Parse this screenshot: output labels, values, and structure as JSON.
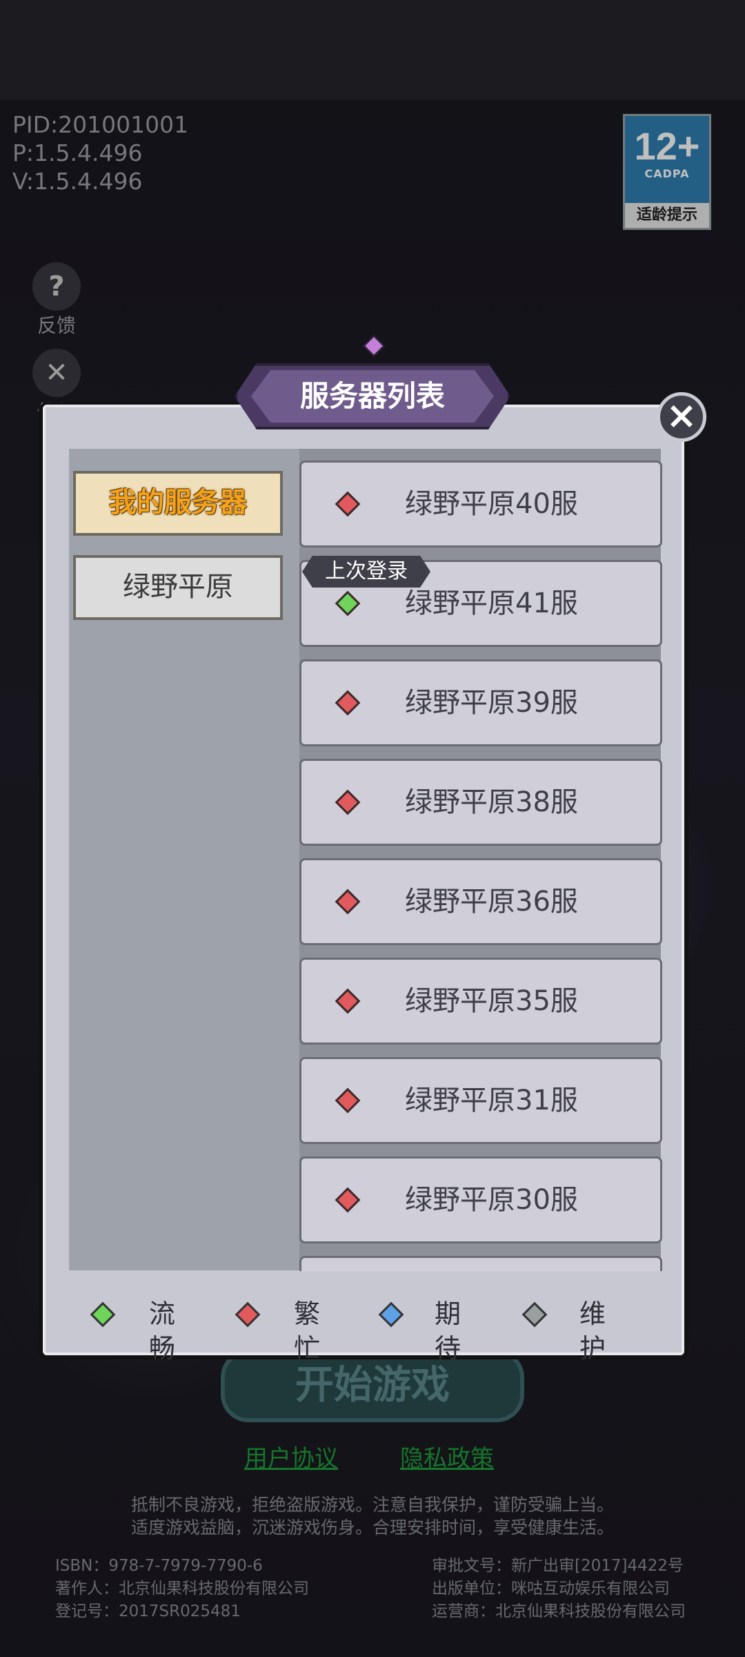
{
  "header": {
    "pid": "PID:201001001",
    "p_version": "P:1.5.4.496",
    "v_version": "V:1.5.4.496"
  },
  "age_rating": {
    "number": "12+",
    "org": "CADPA",
    "tip": "适龄提示"
  },
  "side_buttons": [
    {
      "icon": "question-icon",
      "label": "反馈"
    },
    {
      "icon": "repair-icon",
      "label": "修复"
    }
  ],
  "modal": {
    "title": "服务器列表",
    "tabs": [
      {
        "label": "我的服务器",
        "active": true
      },
      {
        "label": "绿野平原",
        "active": false
      }
    ],
    "last_login_tag": "上次登录",
    "servers": [
      {
        "name": "绿野平原40服",
        "status": "busy"
      },
      {
        "name": "绿野平原41服",
        "status": "smooth"
      },
      {
        "name": "绿野平原39服",
        "status": "busy"
      },
      {
        "name": "绿野平原38服",
        "status": "busy"
      },
      {
        "name": "绿野平原36服",
        "status": "busy"
      },
      {
        "name": "绿野平原35服",
        "status": "busy"
      },
      {
        "name": "绿野平原31服",
        "status": "busy"
      },
      {
        "name": "绿野平原30服",
        "status": "busy"
      }
    ],
    "legend": [
      {
        "label": "流畅",
        "color": "#6ed45a"
      },
      {
        "label": "繁忙",
        "color": "#e25a5e"
      },
      {
        "label": "期待",
        "color": "#5ea1e6"
      },
      {
        "label": "维护",
        "color": "#9aa0a2"
      }
    ]
  },
  "start_button": "开始游戏",
  "links": {
    "agreement": "用户协议",
    "privacy": "隐私政策"
  },
  "notice": [
    "抵制不良游戏，拒绝盗版游戏。注意自我保护，谨防受骗上当。",
    "适度游戏益脑，沉迷游戏伤身。合理安排时间，享受健康生活。"
  ],
  "footer": {
    "isbn": "ISBN：978-7-7979-7790-6",
    "author": "著作人：北京仙果科技股份有限公司",
    "reg": "登记号：2017SR025481",
    "approval": "审批文号：新广出审[2017]4422号",
    "publisher": "出版单位：咪咕互动娱乐有限公司",
    "operator": "运营商：北京仙果科技股份有限公司"
  },
  "colors": {
    "busy": "#e25a5e",
    "smooth": "#6ed45a",
    "expect": "#5ea1e6",
    "maintain": "#9aa0a2",
    "accent_gold": "#f5a11a"
  }
}
